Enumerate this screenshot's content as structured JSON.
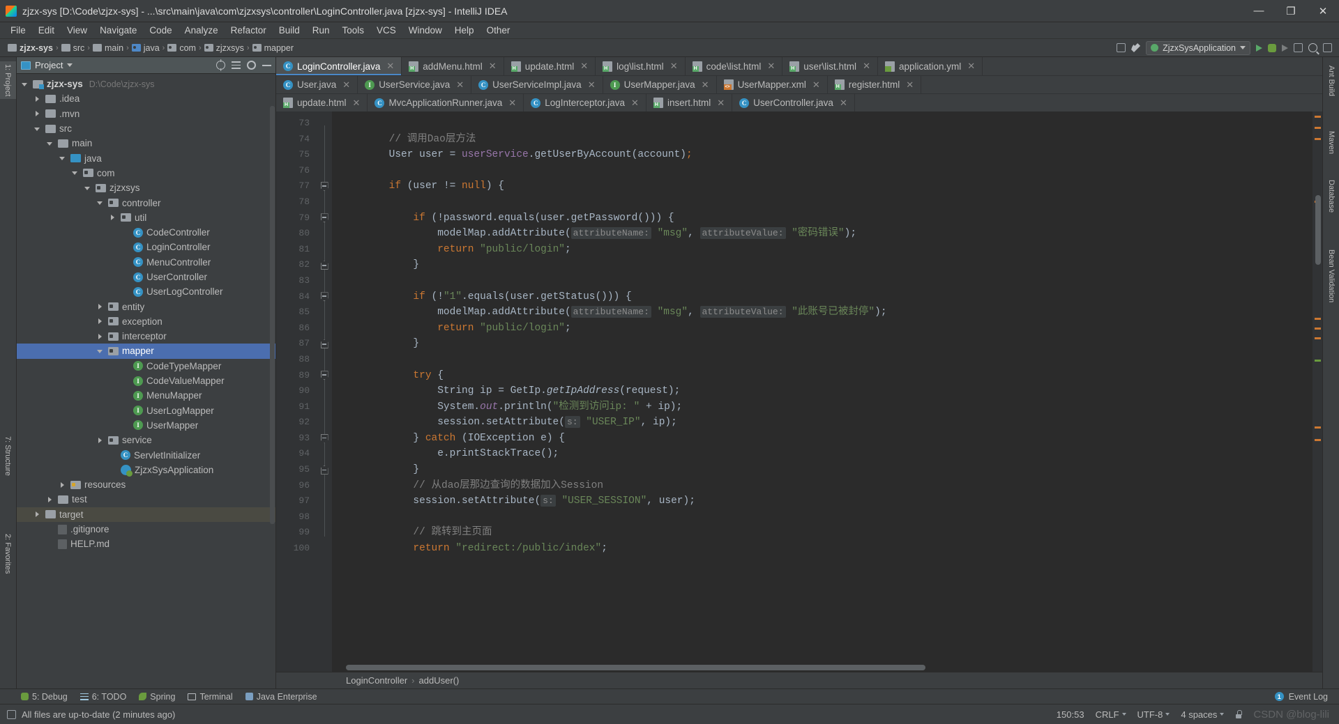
{
  "window": {
    "title": "zjzx-sys [D:\\Code\\zjzx-sys] - ...\\src\\main\\java\\com\\zjzxsys\\controller\\LoginController.java [zjzx-sys] - IntelliJ IDEA",
    "minimize": "—",
    "maximize": "❐",
    "close": "✕"
  },
  "menu": {
    "items": [
      "File",
      "Edit",
      "View",
      "Navigate",
      "Code",
      "Analyze",
      "Refactor",
      "Build",
      "Run",
      "Tools",
      "VCS",
      "Window",
      "Help",
      "Other"
    ]
  },
  "navbar": {
    "crumbs": [
      "zjzx-sys",
      "src",
      "main",
      "java",
      "com",
      "zjzxsys",
      "mapper"
    ],
    "separator": "›",
    "run_config": "ZjzxSysApplication"
  },
  "project_panel": {
    "title": "Project",
    "tree": [
      {
        "label": "zjzx-sys",
        "path": "D:\\Code\\zjzx-sys",
        "indent": 0,
        "arrow": "open",
        "icon": "module",
        "bold": true
      },
      {
        "label": ".idea",
        "indent": 1,
        "arrow": "closed",
        "icon": "folder"
      },
      {
        "label": ".mvn",
        "indent": 1,
        "arrow": "closed",
        "icon": "folder"
      },
      {
        "label": "src",
        "indent": 1,
        "arrow": "open",
        "icon": "folder"
      },
      {
        "label": "main",
        "indent": 2,
        "arrow": "open",
        "icon": "folder"
      },
      {
        "label": "java",
        "indent": 3,
        "arrow": "open",
        "icon": "src"
      },
      {
        "label": "com",
        "indent": 4,
        "arrow": "open",
        "icon": "pkg"
      },
      {
        "label": "zjzxsys",
        "indent": 5,
        "arrow": "open",
        "icon": "pkg"
      },
      {
        "label": "controller",
        "indent": 6,
        "arrow": "open",
        "icon": "pkg"
      },
      {
        "label": "util",
        "indent": 7,
        "arrow": "closed",
        "icon": "pkg"
      },
      {
        "label": "CodeController",
        "indent": 8,
        "arrow": "none",
        "icon": "class"
      },
      {
        "label": "LoginController",
        "indent": 8,
        "arrow": "none",
        "icon": "class"
      },
      {
        "label": "MenuController",
        "indent": 8,
        "arrow": "none",
        "icon": "class"
      },
      {
        "label": "UserController",
        "indent": 8,
        "arrow": "none",
        "icon": "class"
      },
      {
        "label": "UserLogController",
        "indent": 8,
        "arrow": "none",
        "icon": "class"
      },
      {
        "label": "entity",
        "indent": 6,
        "arrow": "closed",
        "icon": "pkg"
      },
      {
        "label": "exception",
        "indent": 6,
        "arrow": "closed",
        "icon": "pkg"
      },
      {
        "label": "interceptor",
        "indent": 6,
        "arrow": "closed",
        "icon": "pkg"
      },
      {
        "label": "mapper",
        "indent": 6,
        "arrow": "open",
        "icon": "pkg",
        "selected": true
      },
      {
        "label": "CodeTypeMapper",
        "indent": 8,
        "arrow": "none",
        "icon": "interface"
      },
      {
        "label": "CodeValueMapper",
        "indent": 8,
        "arrow": "none",
        "icon": "interface"
      },
      {
        "label": "MenuMapper",
        "indent": 8,
        "arrow": "none",
        "icon": "interface"
      },
      {
        "label": "UserLogMapper",
        "indent": 8,
        "arrow": "none",
        "icon": "interface"
      },
      {
        "label": "UserMapper",
        "indent": 8,
        "arrow": "none",
        "icon": "interface"
      },
      {
        "label": "service",
        "indent": 6,
        "arrow": "closed",
        "icon": "pkg"
      },
      {
        "label": "ServletInitializer",
        "indent": 7,
        "arrow": "none",
        "icon": "class"
      },
      {
        "label": "ZjzxSysApplication",
        "indent": 7,
        "arrow": "none",
        "icon": "spring"
      },
      {
        "label": "resources",
        "indent": 3,
        "arrow": "closed",
        "icon": "res"
      },
      {
        "label": "test",
        "indent": 2,
        "arrow": "closed",
        "icon": "folder"
      },
      {
        "label": "target",
        "indent": 1,
        "arrow": "closed",
        "icon": "folder",
        "highlighted": true
      },
      {
        "label": ".gitignore",
        "indent": 2,
        "arrow": "none",
        "icon": "file"
      },
      {
        "label": "HELP.md",
        "indent": 2,
        "arrow": "none",
        "icon": "file"
      }
    ]
  },
  "editor_tabs": {
    "row1": [
      {
        "label": "LoginController.java",
        "icon": "java",
        "active": true,
        "close": "✕"
      },
      {
        "label": "addMenu.html",
        "icon": "html",
        "close": "✕"
      },
      {
        "label": "update.html",
        "icon": "html",
        "close": "✕"
      },
      {
        "label": "log\\list.html",
        "icon": "html",
        "close": "✕"
      },
      {
        "label": "code\\list.html",
        "icon": "html",
        "close": "✕"
      },
      {
        "label": "user\\list.html",
        "icon": "html",
        "close": "✕"
      },
      {
        "label": "application.yml",
        "icon": "yml",
        "close": "✕"
      }
    ],
    "row2": [
      {
        "label": "User.java",
        "icon": "java",
        "close": "✕"
      },
      {
        "label": "UserService.java",
        "icon": "interface",
        "close": "✕"
      },
      {
        "label": "UserServiceImpl.java",
        "icon": "java",
        "close": "✕"
      },
      {
        "label": "UserMapper.java",
        "icon": "interface",
        "close": "✕"
      },
      {
        "label": "UserMapper.xml",
        "icon": "xml",
        "close": "✕"
      },
      {
        "label": "register.html",
        "icon": "html",
        "close": "✕"
      }
    ],
    "row3": [
      {
        "label": "update.html",
        "icon": "html",
        "close": "✕"
      },
      {
        "label": "MvcApplicationRunner.java",
        "icon": "java",
        "close": "✕"
      },
      {
        "label": "LogInterceptor.java",
        "icon": "java",
        "close": "✕"
      },
      {
        "label": "insert.html",
        "icon": "html",
        "close": "✕"
      },
      {
        "label": "UserController.java",
        "icon": "java",
        "close": "✕"
      }
    ]
  },
  "code": {
    "first_line": 73,
    "lines": [
      {
        "n": 73,
        "fold": "none",
        "segs": []
      },
      {
        "n": 74,
        "fold": "none",
        "segs": [
          {
            "t": "        ",
            "c": ""
          },
          {
            "t": "// 调用Dao层方法",
            "c": "cmt"
          }
        ]
      },
      {
        "n": 75,
        "fold": "none",
        "segs": [
          {
            "t": "        User user = ",
            "c": ""
          },
          {
            "t": "userService",
            "c": "fld"
          },
          {
            "t": ".getUserByAccount(account)",
            "c": ""
          },
          {
            "t": ";",
            "c": "kw"
          }
        ]
      },
      {
        "n": 76,
        "fold": "none",
        "segs": []
      },
      {
        "n": 77,
        "fold": "minus",
        "segs": [
          {
            "t": "        ",
            "c": ""
          },
          {
            "t": "if",
            "c": "kw"
          },
          {
            "t": " (user != ",
            "c": ""
          },
          {
            "t": "null",
            "c": "kw"
          },
          {
            "t": ") {",
            "c": ""
          }
        ]
      },
      {
        "n": 78,
        "fold": "none",
        "segs": []
      },
      {
        "n": 79,
        "fold": "minus",
        "segs": [
          {
            "t": "            ",
            "c": ""
          },
          {
            "t": "if",
            "c": "kw"
          },
          {
            "t": " (!password.equals(user.getPassword())) {",
            "c": ""
          }
        ]
      },
      {
        "n": 80,
        "fold": "none",
        "segs": [
          {
            "t": "                modelMap.addAttribute(",
            "c": ""
          },
          {
            "t": "attributeName:",
            "c": "hint"
          },
          {
            "t": " ",
            "c": ""
          },
          {
            "t": "\"msg\"",
            "c": "str"
          },
          {
            "t": ", ",
            "c": ""
          },
          {
            "t": "attributeValue:",
            "c": "hint"
          },
          {
            "t": " ",
            "c": ""
          },
          {
            "t": "\"密码错误\"",
            "c": "str"
          },
          {
            "t": ");",
            "c": ""
          }
        ]
      },
      {
        "n": 81,
        "fold": "none",
        "segs": [
          {
            "t": "                ",
            "c": ""
          },
          {
            "t": "return",
            "c": "kw"
          },
          {
            "t": " ",
            "c": ""
          },
          {
            "t": "\"public/login\"",
            "c": "str"
          },
          {
            "t": ";",
            "c": ""
          }
        ]
      },
      {
        "n": 82,
        "fold": "end",
        "segs": [
          {
            "t": "            }",
            "c": ""
          }
        ]
      },
      {
        "n": 83,
        "fold": "none",
        "segs": []
      },
      {
        "n": 84,
        "fold": "minus",
        "segs": [
          {
            "t": "            ",
            "c": ""
          },
          {
            "t": "if",
            "c": "kw"
          },
          {
            "t": " (!",
            "c": ""
          },
          {
            "t": "\"1\"",
            "c": "str"
          },
          {
            "t": ".equals(user.getStatus())) {",
            "c": ""
          }
        ]
      },
      {
        "n": 85,
        "fold": "none",
        "segs": [
          {
            "t": "                modelMap.addAttribute(",
            "c": ""
          },
          {
            "t": "attributeName:",
            "c": "hint"
          },
          {
            "t": " ",
            "c": ""
          },
          {
            "t": "\"msg\"",
            "c": "str"
          },
          {
            "t": ", ",
            "c": ""
          },
          {
            "t": "attributeValue:",
            "c": "hint"
          },
          {
            "t": " ",
            "c": ""
          },
          {
            "t": "\"此账号已被封停\"",
            "c": "str"
          },
          {
            "t": ");",
            "c": ""
          }
        ]
      },
      {
        "n": 86,
        "fold": "none",
        "segs": [
          {
            "t": "                ",
            "c": ""
          },
          {
            "t": "return",
            "c": "kw"
          },
          {
            "t": " ",
            "c": ""
          },
          {
            "t": "\"public/login\"",
            "c": "str"
          },
          {
            "t": ";",
            "c": ""
          }
        ]
      },
      {
        "n": 87,
        "fold": "end",
        "segs": [
          {
            "t": "            }",
            "c": ""
          }
        ]
      },
      {
        "n": 88,
        "fold": "none",
        "segs": []
      },
      {
        "n": 89,
        "fold": "minus",
        "segs": [
          {
            "t": "            ",
            "c": ""
          },
          {
            "t": "try",
            "c": "kw"
          },
          {
            "t": " {",
            "c": ""
          }
        ]
      },
      {
        "n": 90,
        "fold": "none",
        "segs": [
          {
            "t": "                String ip = GetIp.",
            "c": ""
          },
          {
            "t": "getIpAddress",
            "c": "statm"
          },
          {
            "t": "(request);",
            "c": ""
          }
        ]
      },
      {
        "n": 91,
        "fold": "none",
        "segs": [
          {
            "t": "                System.",
            "c": ""
          },
          {
            "t": "out",
            "c": "stat"
          },
          {
            "t": ".println(",
            "c": ""
          },
          {
            "t": "\"检测到访问ip: \"",
            "c": "str"
          },
          {
            "t": " + ip);",
            "c": ""
          }
        ]
      },
      {
        "n": 92,
        "fold": "none",
        "segs": [
          {
            "t": "                session.setAttribute(",
            "c": ""
          },
          {
            "t": "s:",
            "c": "hint"
          },
          {
            "t": " ",
            "c": ""
          },
          {
            "t": "\"USER_IP\"",
            "c": "str"
          },
          {
            "t": ", ip);",
            "c": ""
          }
        ]
      },
      {
        "n": 93,
        "fold": "minus",
        "segs": [
          {
            "t": "            } ",
            "c": ""
          },
          {
            "t": "catch",
            "c": "kw"
          },
          {
            "t": " (IOException e) {",
            "c": ""
          }
        ]
      },
      {
        "n": 94,
        "fold": "none",
        "segs": [
          {
            "t": "                e.printStackTrace();",
            "c": ""
          }
        ]
      },
      {
        "n": 95,
        "fold": "end",
        "segs": [
          {
            "t": "            }",
            "c": ""
          }
        ]
      },
      {
        "n": 96,
        "fold": "none",
        "segs": [
          {
            "t": "            ",
            "c": ""
          },
          {
            "t": "// 从dao层那边查询的数据加入Session",
            "c": "cmt"
          }
        ]
      },
      {
        "n": 97,
        "fold": "none",
        "segs": [
          {
            "t": "            session.setAttribute(",
            "c": ""
          },
          {
            "t": "s:",
            "c": "hint"
          },
          {
            "t": " ",
            "c": ""
          },
          {
            "t": "\"USER_SESSION\"",
            "c": "str"
          },
          {
            "t": ", user);",
            "c": ""
          }
        ]
      },
      {
        "n": 98,
        "fold": "none",
        "segs": []
      },
      {
        "n": 99,
        "fold": "none",
        "segs": [
          {
            "t": "            ",
            "c": ""
          },
          {
            "t": "// 跳转到主页面",
            "c": "cmt"
          }
        ]
      },
      {
        "n": 100,
        "fold": "none",
        "segs": [
          {
            "t": "            ",
            "c": ""
          },
          {
            "t": "return",
            "c": "kw"
          },
          {
            "t": " ",
            "c": ""
          },
          {
            "t": "\"redirect:/public/index\"",
            "c": "str"
          },
          {
            "t": ";",
            "c": ""
          }
        ]
      }
    ],
    "breadcrumb": {
      "class": "LoginController",
      "method": "addUser()",
      "separator": "›"
    }
  },
  "left_tool_tabs": [
    {
      "label": "1: Project",
      "selected": true
    },
    {
      "label": "7: Structure"
    },
    {
      "label": "2: Favorites"
    }
  ],
  "right_tool_tabs": [
    {
      "label": "Ant Build"
    },
    {
      "label": "Maven"
    },
    {
      "label": "Database"
    },
    {
      "label": "Bean Validation"
    }
  ],
  "bottom_bar": {
    "items": [
      {
        "label": "5: Debug",
        "icon": "bug-icon"
      },
      {
        "label": "6: TODO",
        "icon": "todo-icon"
      },
      {
        "label": "Spring",
        "icon": "leaf-icon"
      },
      {
        "label": "Terminal",
        "icon": "terminal-icon"
      },
      {
        "label": "Java Enterprise",
        "icon": "jee-icon"
      }
    ],
    "event_log": "Event Log",
    "event_count": "1"
  },
  "status_bar": {
    "message": "All files are up-to-date (2 minutes ago)",
    "caret": "150:53",
    "line_sep": "CRLF",
    "encoding": "UTF-8",
    "indent": "4 spaces",
    "watermark": "CSDN @blog-lili"
  },
  "colors": {
    "accent": "#4b6eaf",
    "panel": "#3c3f41",
    "editor_bg": "#2b2b2b",
    "selection": "#4b6eaf",
    "string": "#6a8759",
    "keyword": "#cc7832",
    "comment": "#808080",
    "field": "#9876aa"
  }
}
